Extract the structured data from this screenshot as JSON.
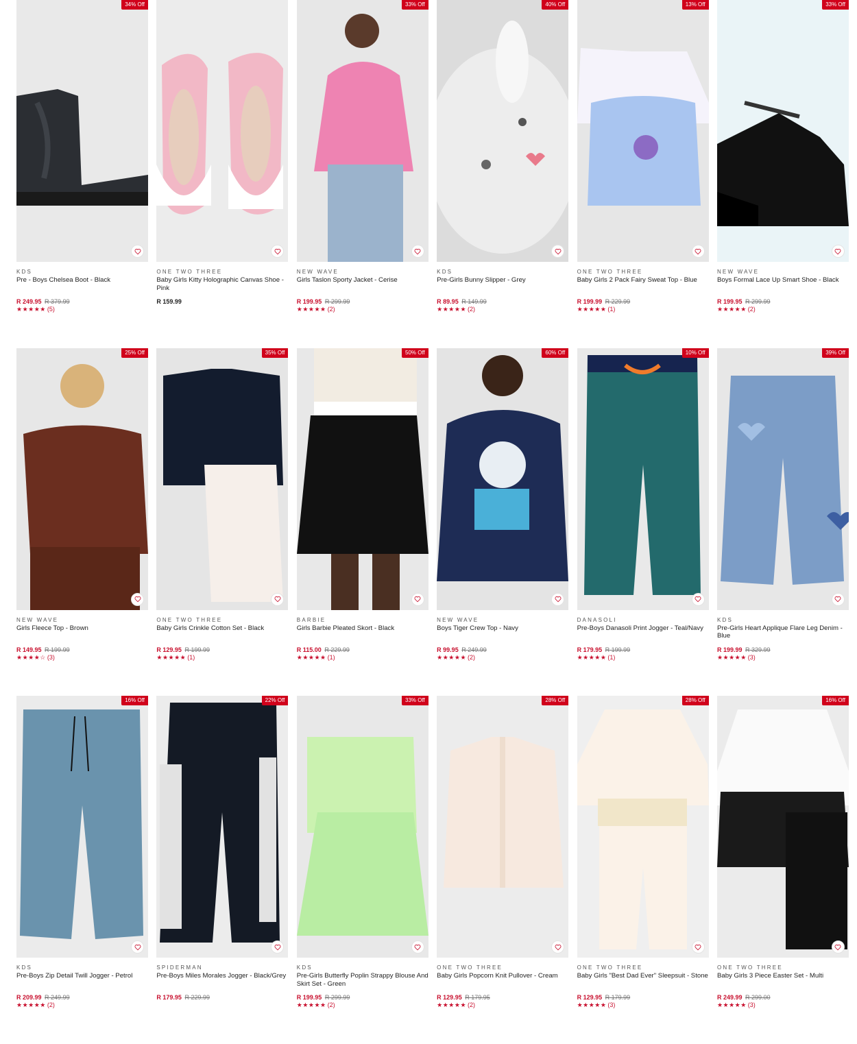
{
  "colors": {
    "sale": "#d0021b",
    "price": "#c8102e",
    "star": "#c8102e"
  },
  "icons": {
    "wishlist": "heart-icon",
    "rating": "star-icon"
  },
  "products": [
    {
      "badge": "34% Off",
      "brand": "KDS",
      "name": "Pre - Boys Chelsea Boot - Black",
      "price": "R 249.95",
      "was": "R 379.99",
      "stars": "★★★★★",
      "count": "(5)",
      "image": "black chelsea boot"
    },
    {
      "badge": "",
      "brand": "ONE TWO THREE",
      "name": "Baby Girls Kitty Holographic Canvas Shoe - Pink",
      "price": "R 159.99",
      "was": "",
      "stars": "",
      "count": "",
      "image": "pink kitty shoes"
    },
    {
      "badge": "33% Off",
      "brand": "NEW WAVE",
      "name": "Girls Taslon Sporty Jacket - Cerise",
      "price": "R 199.95",
      "was": "R 299.99",
      "stars": "★★★★★",
      "count": "(2)",
      "image": "pink jacket"
    },
    {
      "badge": "40% Off",
      "brand": "KDS",
      "name": "Pre-Girls Bunny Slipper - Grey",
      "price": "R 89.95",
      "was": "R 149.99",
      "stars": "★★★★★",
      "count": "(2)",
      "image": "grey bunny slipper"
    },
    {
      "badge": "13% Off",
      "brand": "ONE TWO THREE",
      "name": "Baby Girls 2 Pack Fairy Sweat Top - Blue",
      "price": "R 199.99",
      "was": "R 229.99",
      "stars": "★★★★★",
      "count": "(1)",
      "image": "fairy sweat tops"
    },
    {
      "badge": "33% Off",
      "brand": "NEW WAVE",
      "name": "Boys Formal Lace Up Smart Shoe - Black",
      "price": "R 199.95",
      "was": "R 299.99",
      "stars": "★★★★★",
      "count": "(2)",
      "image": "black formal shoe"
    },
    {
      "badge": "25% Off",
      "brand": "NEW WAVE",
      "name": "Girls Fleece Top - Brown",
      "price": "R 149.95",
      "was": "R 199.99",
      "stars": "★★★★☆",
      "count": "(3)",
      "image": "brown fleece top"
    },
    {
      "badge": "35% Off",
      "brand": "ONE TWO THREE",
      "name": "Baby Girls Crinkle Cotton Set - Black",
      "price": "R 129.95",
      "was": "R 199.99",
      "stars": "★★★★★",
      "count": "(1)",
      "image": "black top and white pants"
    },
    {
      "badge": "50% Off",
      "brand": "BARBIE",
      "name": "Girls Barbie Pleated Skort - Black",
      "price": "R 115.00",
      "was": "R 229.99",
      "stars": "★★★★★",
      "count": "(1)",
      "image": "black pleated skort"
    },
    {
      "badge": "60% Off",
      "brand": "NEW WAVE",
      "name": "Boys Tiger Crew Top - Navy",
      "price": "R 99.95",
      "was": "R 249.99",
      "stars": "★★★★★",
      "count": "(2)",
      "image": "navy tiger sweatshirt"
    },
    {
      "badge": "10% Off",
      "brand": "DANASOLI",
      "name": "Pre-Boys Danasoli Print Jogger - Teal/Navy",
      "price": "R 179.95",
      "was": "R 199.99",
      "stars": "★★★★★",
      "count": "(1)",
      "image": "teal print jogger"
    },
    {
      "badge": "39% Off",
      "brand": "KDS",
      "name": "Pre-Girls Heart Applique Flare Leg Denim - Blue",
      "price": "R 199.99",
      "was": "R 329.99",
      "stars": "★★★★★",
      "count": "(3)",
      "image": "heart denim jeans"
    },
    {
      "badge": "16% Off",
      "brand": "KDS",
      "name": "Pre-Boys Zip Detail Twill Jogger - Petrol",
      "price": "R 209.99",
      "was": "R 249.99",
      "stars": "★★★★★",
      "count": "(2)",
      "image": "petrol twill jogger"
    },
    {
      "badge": "22% Off",
      "brand": "SPIDERMAN",
      "name": "Pre-Boys Miles Morales Jogger - Black/Grey",
      "price": "R 179.95",
      "was": "R 229.99",
      "stars": "",
      "count": "",
      "image": "spiderman jogger"
    },
    {
      "badge": "33% Off",
      "brand": "KDS",
      "name": "Pre-Girls Butterfly Poplin Strappy Blouse And Skirt Set - Green",
      "price": "R 199.95",
      "was": "R 299.99",
      "stars": "★★★★★",
      "count": "(2)",
      "image": "green blouse and skirt"
    },
    {
      "badge": "28% Off",
      "brand": "ONE TWO THREE",
      "name": "Baby Girls Popcorn Knit Pullover - Cream",
      "price": "R 129.95",
      "was": "R 179.95",
      "stars": "★★★★★",
      "count": "(2)",
      "image": "cream knit cardigan"
    },
    {
      "badge": "28% Off",
      "brand": "ONE TWO THREE",
      "name": "Baby Girls \"Best Dad Ever\" Sleepsuit - Stone",
      "price": "R 129.95",
      "was": "R 179.99",
      "stars": "★★★★★",
      "count": "(3)",
      "image": "stone sleepsuit"
    },
    {
      "badge": "16% Off",
      "brand": "ONE TWO THREE",
      "name": "Baby Girls 3 Piece Easter Set - Multi",
      "price": "R 249.99",
      "was": "R 299.00",
      "stars": "★★★★★",
      "count": "(3)",
      "image": "easter set"
    }
  ]
}
